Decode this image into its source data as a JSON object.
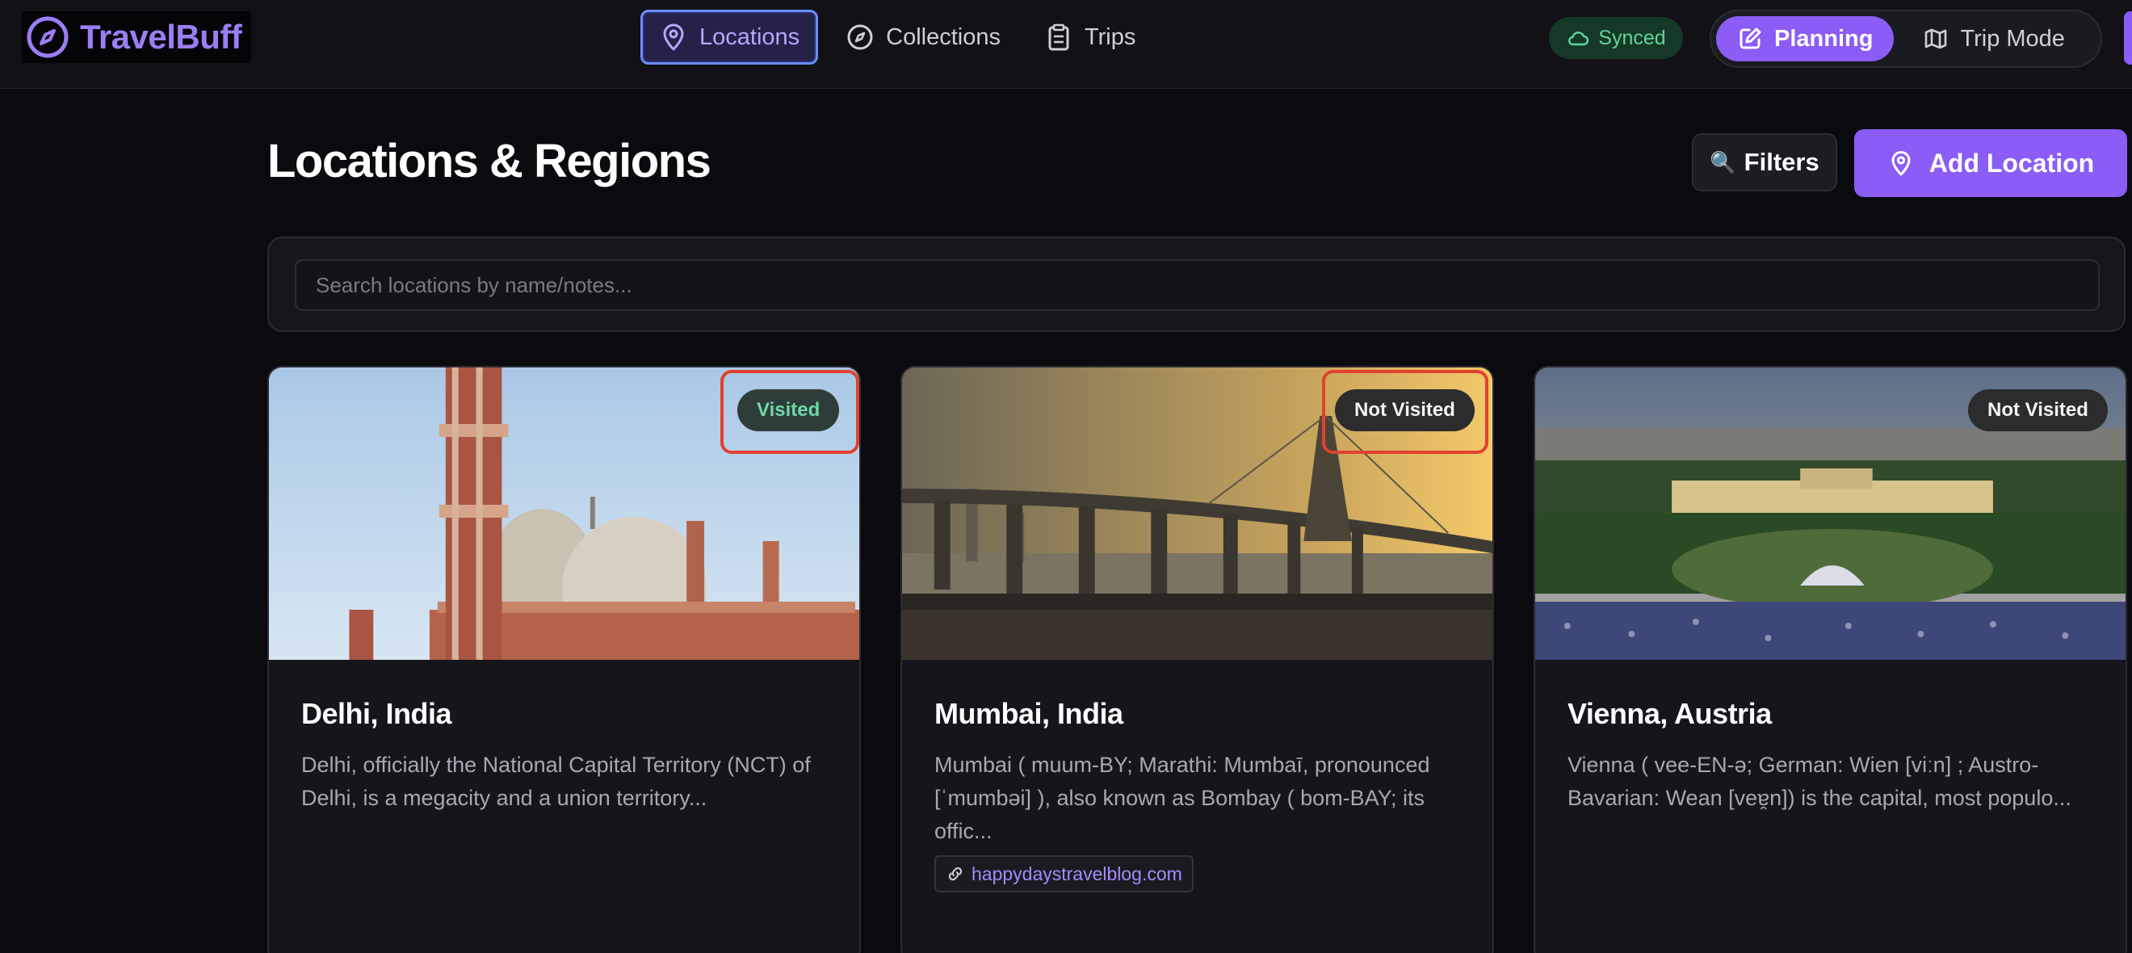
{
  "app": {
    "name": "TravelBuff",
    "brand_color": "#8b5cf6"
  },
  "nav": {
    "items": [
      {
        "label": "Locations",
        "icon": "map-pin-icon",
        "active": true
      },
      {
        "label": "Collections",
        "icon": "compass-icon",
        "active": false
      },
      {
        "label": "Trips",
        "icon": "clipboard-icon",
        "active": false
      }
    ]
  },
  "sync": {
    "label": "Synced",
    "icon": "cloud-icon",
    "color": "#5fd59a"
  },
  "mode": {
    "planning_label": "Planning",
    "trip_label": "Trip Mode",
    "active": "planning"
  },
  "page": {
    "title": "Locations & Regions",
    "filters_label": "Filters",
    "filters_emoji": "🔍",
    "add_label": "Add Location"
  },
  "search": {
    "placeholder": "Search locations by name/notes...",
    "value": ""
  },
  "cards": [
    {
      "title": "Delhi, India",
      "status": "Visited",
      "description": "Delhi, officially the National Capital Territory (NCT) of Delhi, is a megacity and a union territory...",
      "link": ""
    },
    {
      "title": "Mumbai, India",
      "status": "Not Visited",
      "description": "Mumbai ( muum-BY; Marathi: Mumbaī, pronounced [ˈmumbəi] ), also known as Bombay ( bom-BAY; its offic...",
      "link": "happydaystravelblog.com"
    },
    {
      "title": "Vienna, Austria",
      "status": "Not Visited",
      "description": "Vienna ( vee-EN-ə; German: Wien [viːn] ; Austro-Bavarian: Wean [veɐ̯n]) is the capital, most populo...",
      "link": ""
    }
  ]
}
